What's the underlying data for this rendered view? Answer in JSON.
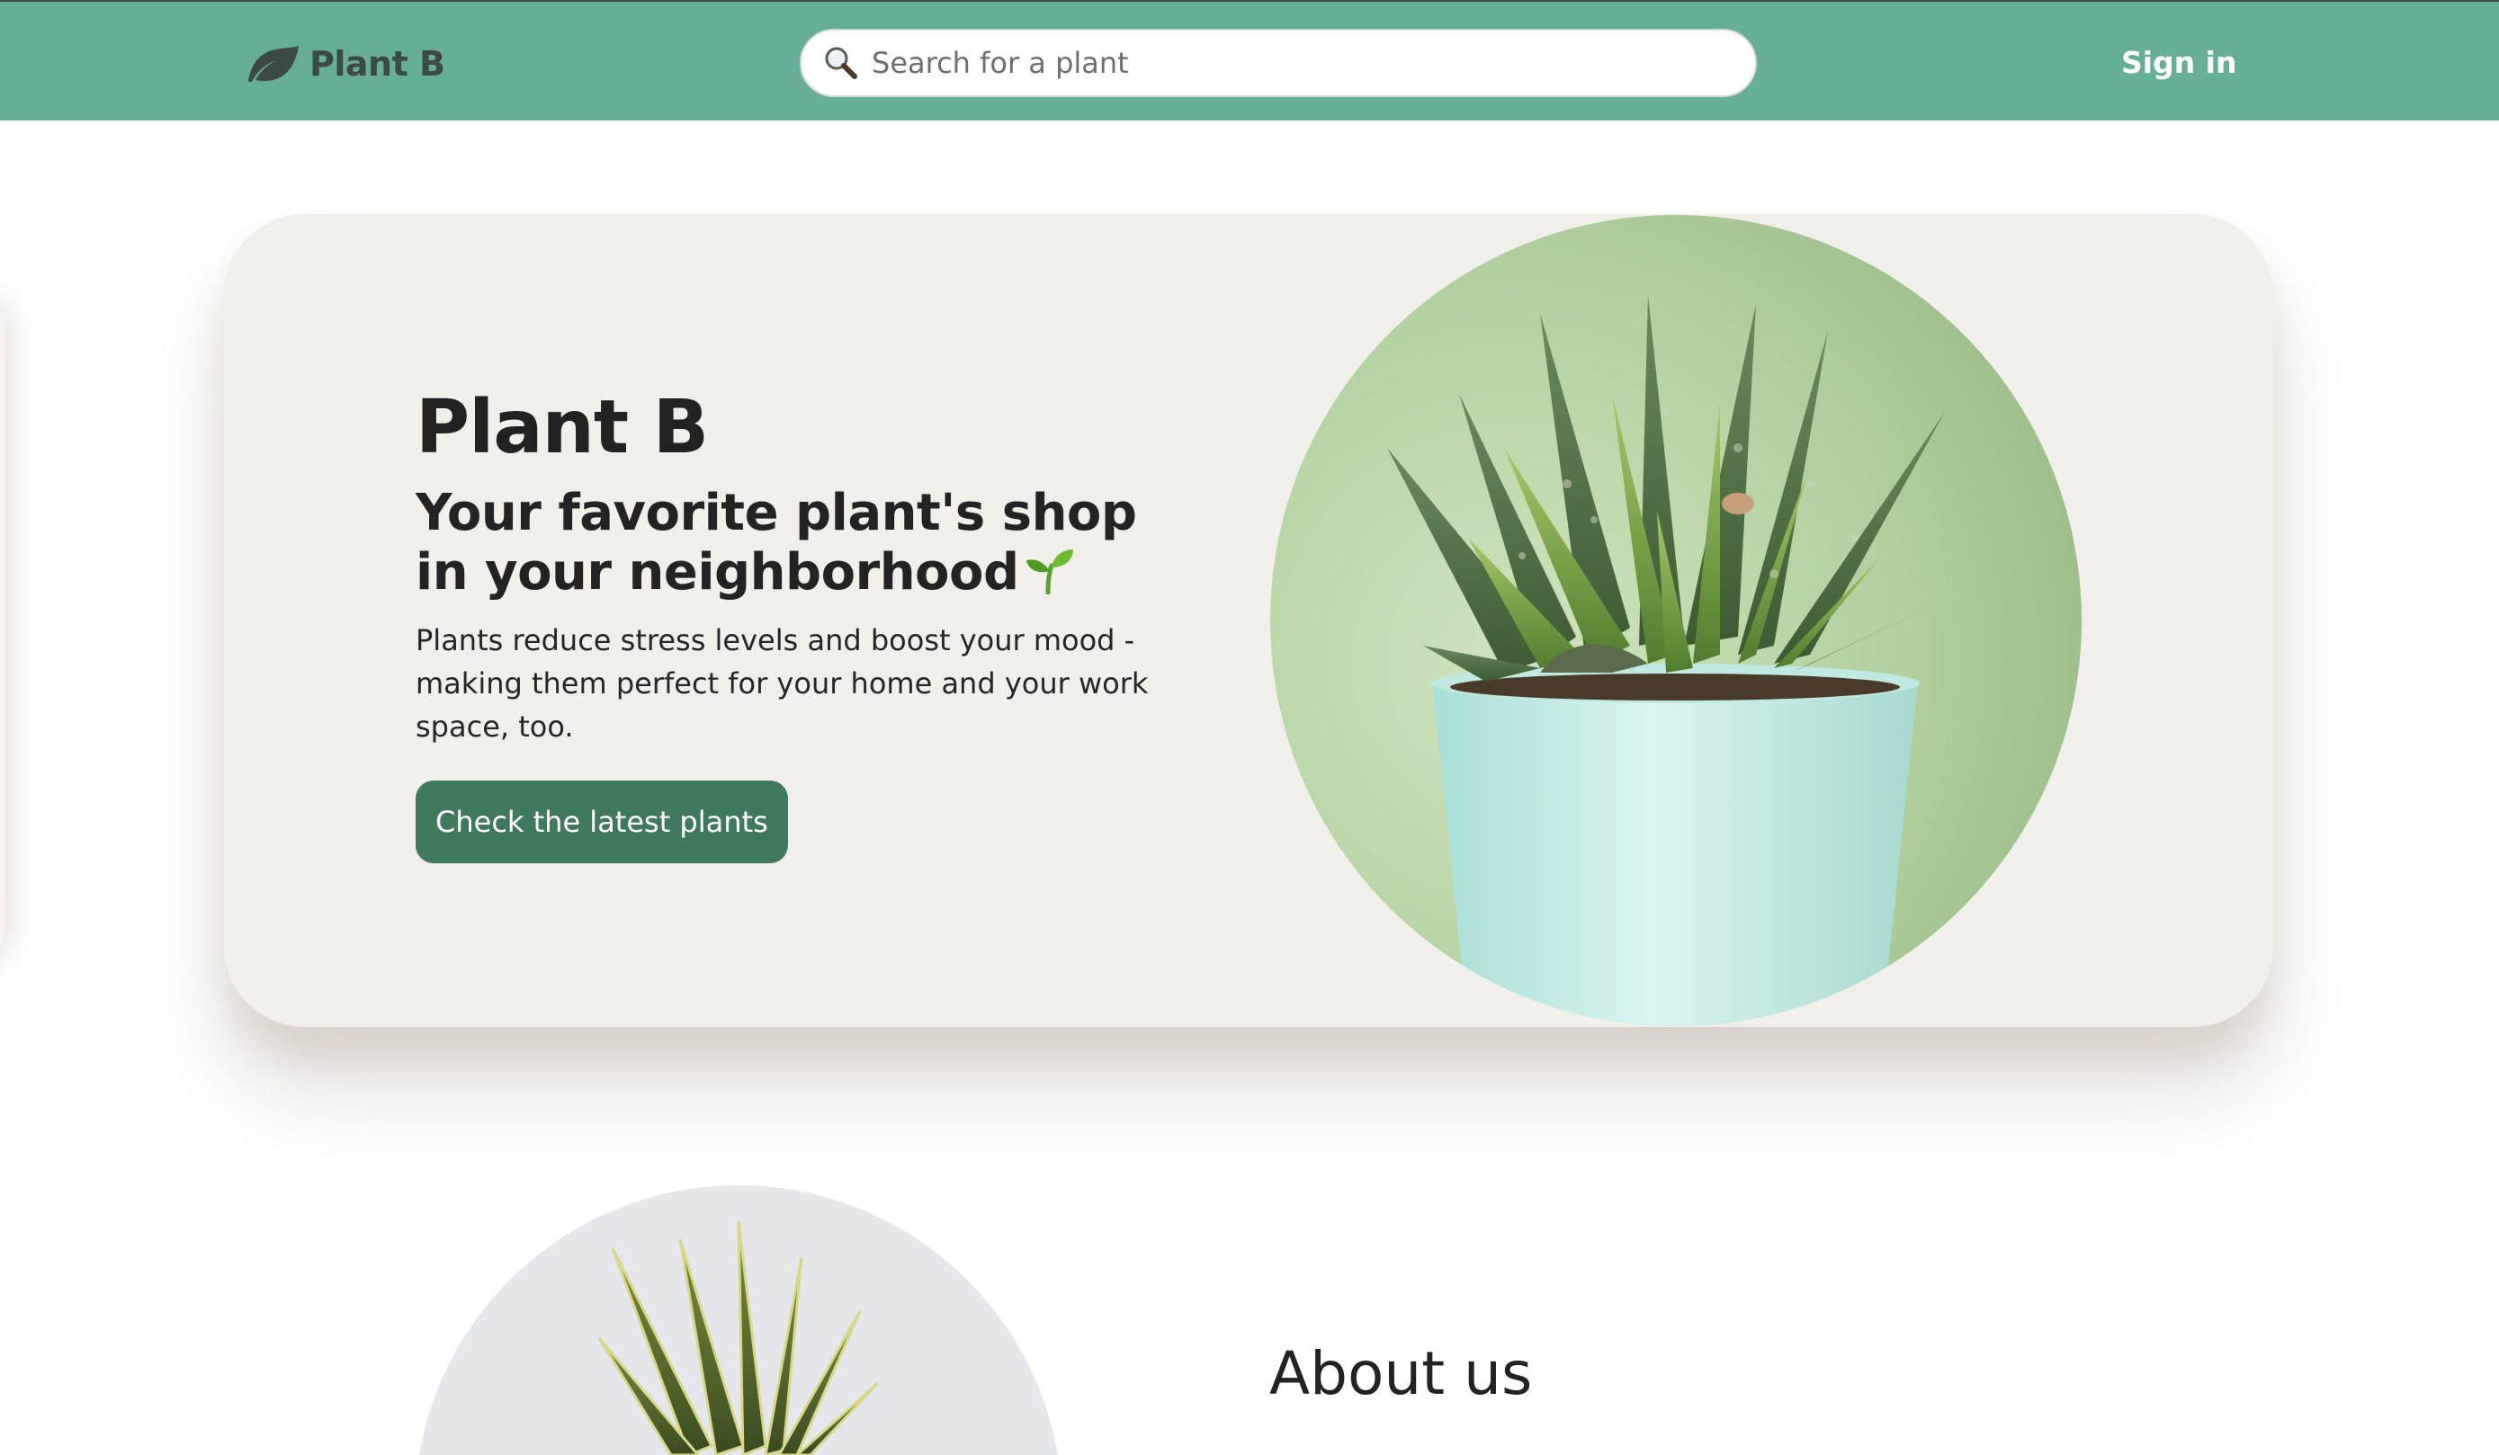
{
  "header": {
    "brand": "Plant B",
    "search_placeholder": "Search for a plant",
    "signin_label": "Sign in"
  },
  "hero": {
    "title": "Plant B",
    "subtitle": "Your favorite plant's shop in your neighborhood",
    "description": "Plants reduce stress levels and boost your mood - making them perfect for your home and your work space, too.",
    "cta_label": "Check the latest plants"
  },
  "about": {
    "title": "About us"
  },
  "colors": {
    "navbar": "#67ae99",
    "brand_text": "#3b4a46",
    "hero_card": "#f0efea",
    "cta_button": "#3f7a5d",
    "hero_circle": "#a7c795",
    "pot": "#c6ede6"
  },
  "icons": {
    "brand": "leaf-icon",
    "search": "magnifier-icon",
    "subtitle_emoji": "sprout-icon"
  }
}
